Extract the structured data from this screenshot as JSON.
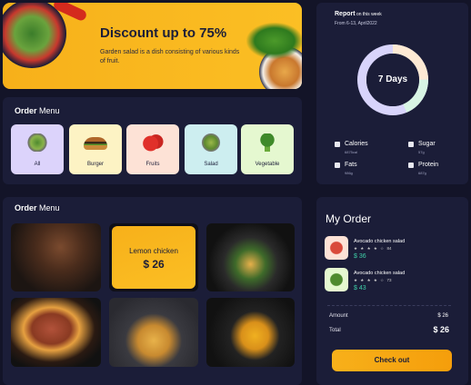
{
  "banner": {
    "title": "Discount up to 75%",
    "desc": "Garden salad is a dish consisting of various kinds of fruit."
  },
  "order_menu_1": {
    "title_bold": "Order",
    "title_rest": " Menu"
  },
  "categories": [
    {
      "label": "All",
      "color": "#dcd3fb",
      "icon": "salad-bowl-icon"
    },
    {
      "label": "Burger",
      "color": "#fdf3c4",
      "icon": "burger-icon"
    },
    {
      "label": "Fruits",
      "color": "#fde2d6",
      "icon": "strawberry-icon"
    },
    {
      "label": "Salad",
      "color": "#cdeef0",
      "icon": "salad-icon"
    },
    {
      "label": "Vegetable",
      "color": "#e5f8d0",
      "icon": "broccoli-icon"
    }
  ],
  "order_menu_2": {
    "title_bold": "Order",
    "title_rest": " Menu"
  },
  "featured": {
    "name": "Lemon chicken",
    "price": "$ 26"
  },
  "report": {
    "title_bold": "Report",
    "title_rest": " on this week",
    "range": "From 6-13, April2022",
    "center": "7 Days",
    "legend": [
      {
        "label": "Calories",
        "sub": "6875cal"
      },
      {
        "label": "Sugar",
        "sub": "57g"
      },
      {
        "label": "Fats",
        "sub": "986g"
      },
      {
        "label": "Protein",
        "sub": "687g"
      }
    ]
  },
  "my_order": {
    "title": "My Order",
    "items": [
      {
        "name": "Avocado chicken salad",
        "stars": "★ ★ ★ ★ ☆",
        "rating": "84",
        "price": "$ 36"
      },
      {
        "name": "Avocado chicken salad",
        "stars": "★ ★ ★ ★ ☆",
        "rating": "73",
        "price": "$ 43"
      }
    ],
    "amount_label": "Amount",
    "amount_value": "$ 26",
    "total_label": "Total",
    "total_value": "$ 26",
    "checkout": "Check out"
  },
  "colors": {
    "accent": "#f7b01a",
    "panel": "#1b1d38",
    "bg": "#131428",
    "price": "#3fd0a8"
  }
}
